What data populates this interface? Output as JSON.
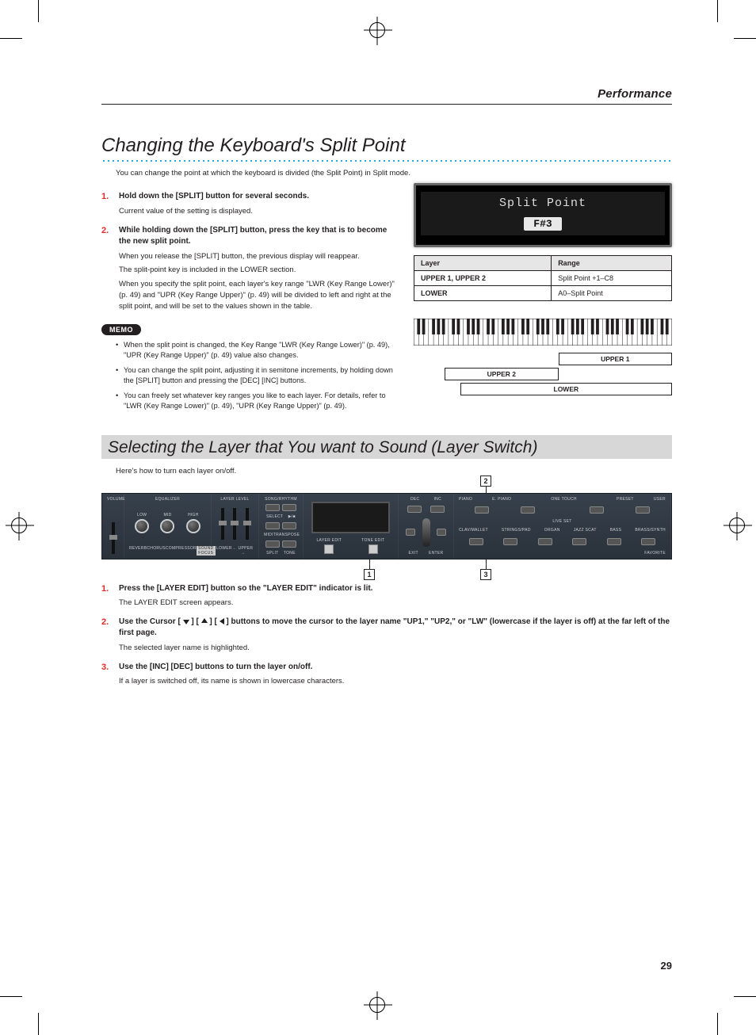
{
  "header": {
    "section": "Performance"
  },
  "page_number": "29",
  "section1": {
    "title": "Changing the Keyboard's Split Point",
    "intro": "You can change the point at which the keyboard is divided (the Split Point) in Split mode.",
    "steps": [
      {
        "head": "Hold down the [SPLIT] button for several seconds.",
        "body": [
          "Current value of the setting is displayed."
        ]
      },
      {
        "head": "While holding down the [SPLIT] button, press the key that is to become the new split point.",
        "body": [
          "When you release the [SPLIT] button, the previous display will reappear.",
          "The split-point key is included in the LOWER section.",
          "When you specify the split point, each layer's key range \"LWR (Key Range Lower)\" (p. 49) and \"UPR (Key Range Upper)\" (p. 49) will be divided to left and right at the split point, and will be set to the values shown in the table."
        ]
      }
    ],
    "memo_label": "MEMO",
    "memo": [
      "When the split point is changed, the Key Range \"LWR (Key Range Lower)\" (p. 49),  \"UPR (Key Range Upper)\" (p. 49) value also changes.",
      "You can change the split point, adjusting it in semitone increments, by holding down the [SPLIT] button and pressing the [DEC] [INC] buttons.",
      "You can freely set whatever key ranges you like to each layer. For details, refer to \"LWR (Key Range Lower)\" (p. 49),  \"UPR (Key Range Upper)\" (p. 49)."
    ],
    "lcd": {
      "line1": "Split Point",
      "line2": "F#3"
    },
    "table": {
      "headers": [
        "Layer",
        "Range"
      ],
      "rows": [
        [
          "UPPER 1, UPPER 2",
          "Split Point +1–C8"
        ],
        [
          "LOWER",
          "A0–Split Point"
        ]
      ]
    },
    "diagram": {
      "upper1": "UPPER 1",
      "upper2": "UPPER 2",
      "lower": "LOWER"
    }
  },
  "section2": {
    "title": "Selecting the Layer that You want to Sound (Layer Switch)",
    "intro": "Here's how to turn each layer on/off.",
    "callouts": [
      "1",
      "2",
      "3"
    ],
    "panel_labels": {
      "volume": "VOLUME",
      "equalizer": "EQUALIZER",
      "low": "LOW",
      "mid": "MID",
      "high": "HIGH",
      "reverb": "REVERB",
      "chorus": "CHORUS",
      "compressor": "COMPRESSOR",
      "sound_focus": "SOUND FOCUS",
      "layer_level": "LAYER LEVEL",
      "lower": "LOWER",
      "upper2_s": "← UPPER →",
      "song_rhythm": "SONG/RHYTHM",
      "select": "SELECT",
      "play": "▶/■",
      "midi": "MIDI",
      "transpose": "TRANSPOSE",
      "split": "SPLIT",
      "tone": "TONE",
      "layer_edit": "LAYER EDIT",
      "tone_edit": "TONE EDIT",
      "dec": "DEC",
      "inc": "INC",
      "enter": "ENTER",
      "exit": "EXIT",
      "piano": "PIANO",
      "epiano": "E. PIANO",
      "preset": "PRESET",
      "user": "USER",
      "favorite": "FAVORITE",
      "one_touch": "ONE TOUCH",
      "live_set": "LIVE SET",
      "clav": "CLAV/MALLET",
      "strings": "STRINGS/PAD",
      "organ": "ORGAN",
      "other": "JAZZ SCAT",
      "bass": "BASS",
      "synth": "BRASS/SYNTH"
    },
    "steps": [
      {
        "head": "Press the [LAYER EDIT] button so the \"LAYER EDIT\" indicator is lit.",
        "body": [
          "The LAYER EDIT screen appears."
        ]
      },
      {
        "head_parts": {
          "a": "Use the Cursor [",
          "b": "] [",
          "c": "] [",
          "d": "] buttons to move the cursor to the layer name \"UP1,\" \"UP2,\" or \"LW\" (lowercase if the layer is off) at the far left of the first page."
        },
        "body": [
          "The selected layer name is highlighted."
        ]
      },
      {
        "head": "Use the [INC] [DEC] buttons to turn the layer on/off.",
        "body": [
          "If a layer is switched off, its name is shown in lowercase characters."
        ]
      }
    ]
  }
}
